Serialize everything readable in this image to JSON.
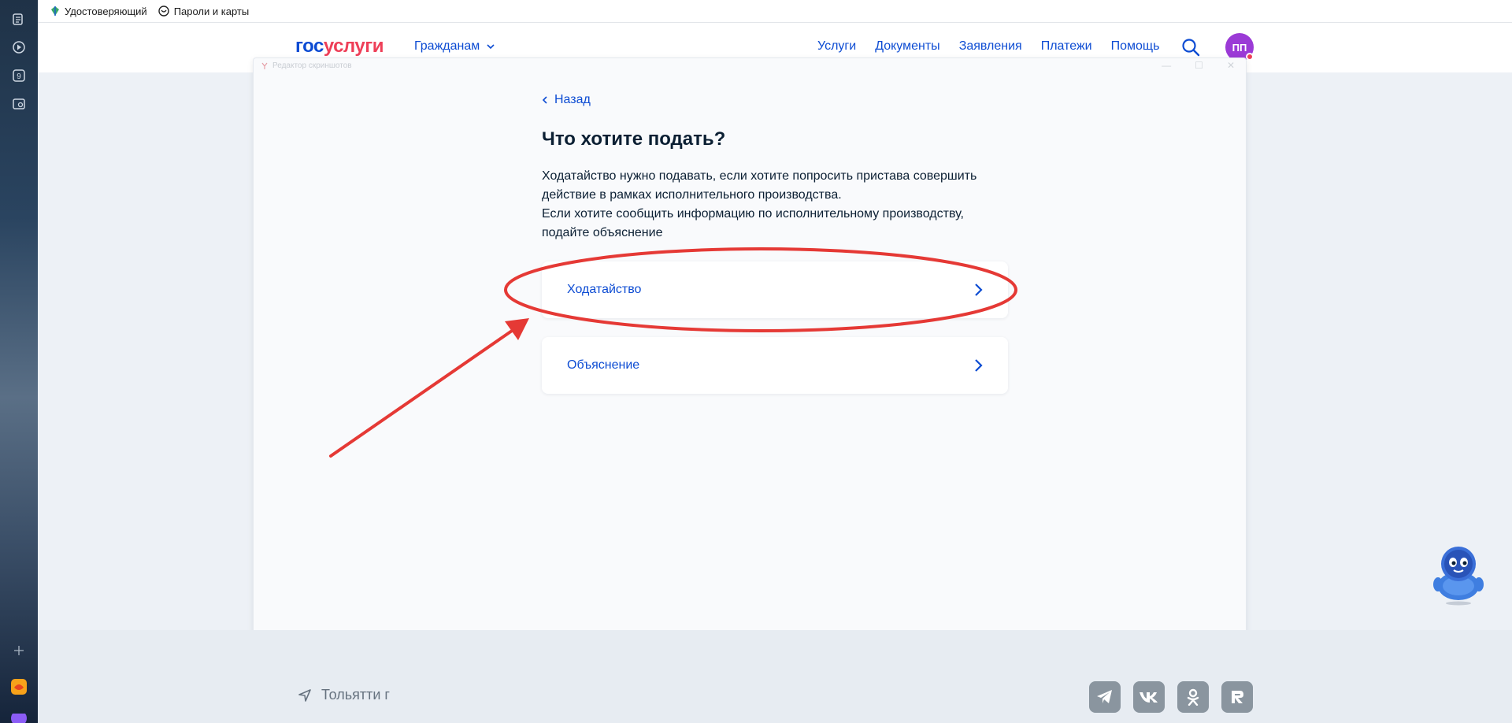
{
  "bookmarks": [
    {
      "label": "Удостоверяющий",
      "icon": "leaf-icon"
    },
    {
      "label": "Пароли и карты",
      "icon": "key-icon"
    }
  ],
  "header": {
    "logo_part1": "гос",
    "logo_part2": "услуги",
    "citizens_label": "Гражданам",
    "nav": [
      "Услуги",
      "Документы",
      "Заявления",
      "Платежи",
      "Помощь"
    ],
    "avatar_initials": "ПП"
  },
  "editor": {
    "title": "Редактор скриншотов"
  },
  "main": {
    "back_label": "Назад",
    "title": "Что хотите подать?",
    "description": [
      "Ходатайство нужно подавать, если хотите попросить пристава совершить действие в рамках исполнительного производства.",
      "Если хотите сообщить информацию по исполнительному производству, подайте объяснение"
    ],
    "options": [
      {
        "label": "Ходатайство"
      },
      {
        "label": "Объяснение"
      }
    ]
  },
  "footer": {
    "location": "Тольятти г",
    "socials": [
      "telegram-icon",
      "vk-icon",
      "odnoklassniki-icon",
      "rutube-icon"
    ]
  },
  "colors": {
    "brand_blue": "#0d4cd3",
    "brand_red": "#ee3f58",
    "annotation_red": "#e53935",
    "avatar": "#9b3ad6"
  }
}
